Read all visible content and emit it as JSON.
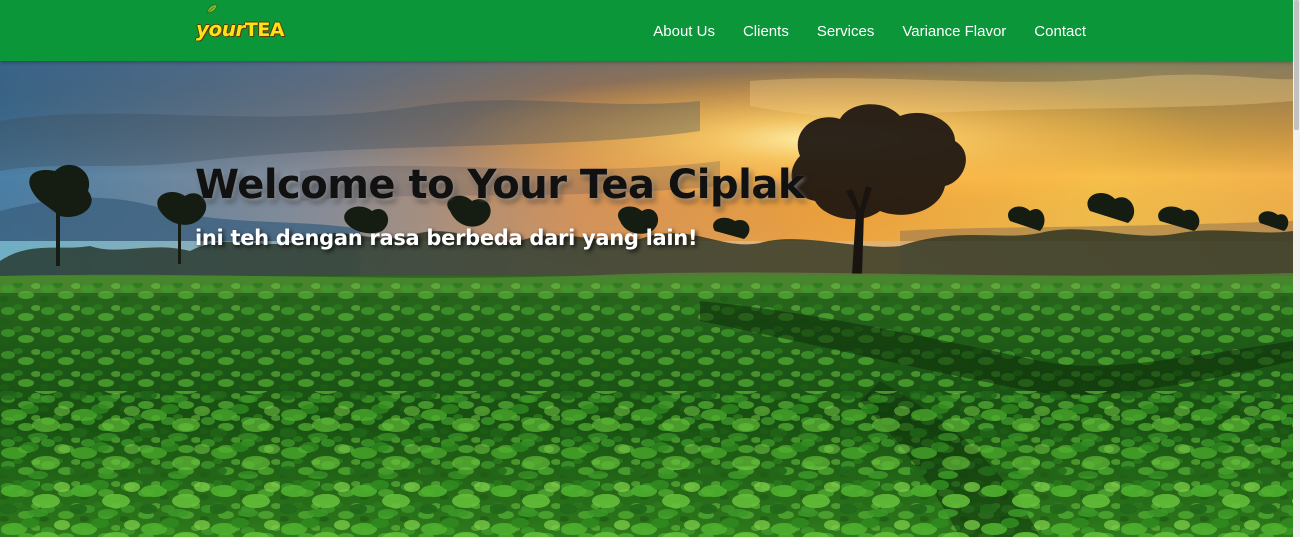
{
  "brand": {
    "logo_text_your": "your",
    "logo_text_tea": "TEA",
    "logo_icon": "leaf-icon"
  },
  "nav": {
    "items": [
      {
        "label": "About Us"
      },
      {
        "label": "Clients"
      },
      {
        "label": "Services"
      },
      {
        "label": "Variance Flavor"
      },
      {
        "label": "Contact"
      }
    ]
  },
  "hero": {
    "title": "Welcome to Your Tea Ciplak",
    "subtitle": "ini teh dengan rasa berbeda dari yang lain!",
    "background": "tea-plantation-sunset-image"
  },
  "colors": {
    "navbar": "#0b9639",
    "logo": "#ffe11a",
    "nav_text": "#ffffff",
    "title": "#111111",
    "subtitle": "#ffffff"
  }
}
